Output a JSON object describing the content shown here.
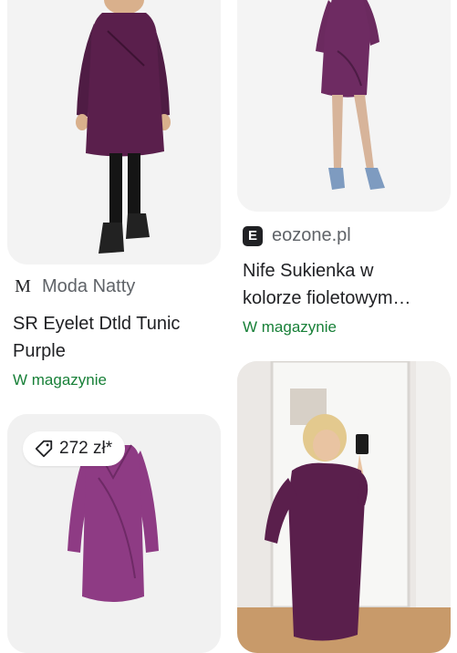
{
  "cards": [
    {
      "source": "Moda Natty",
      "source_icon": "M",
      "title_lines": [
        "SR Eyelet Dtld Tunic",
        "Purple"
      ],
      "availability": "W magazynie"
    },
    {
      "source": "eozone.pl",
      "source_icon": "E",
      "title_lines": [
        "Nife Sukienka w",
        "kolorze fioletowym…"
      ],
      "availability": "W magazynie"
    },
    {
      "price": "272 zł*"
    }
  ],
  "colors": {
    "garment_purple": "#5a1f4c",
    "garment_magenta": "#8e3b84",
    "stock_green": "#188038"
  }
}
